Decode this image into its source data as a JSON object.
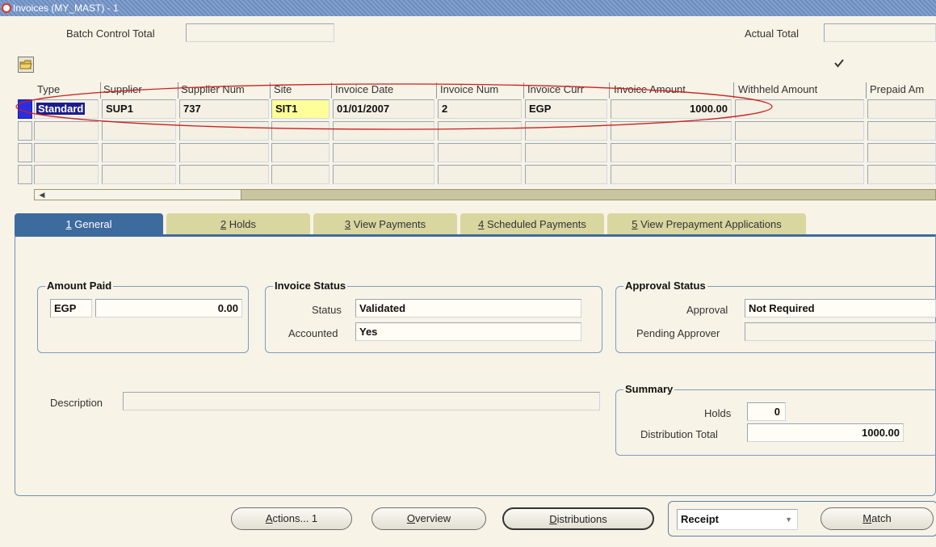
{
  "window": {
    "title": "Invoices (MY_MAST) - 1"
  },
  "batch": {
    "control_label": "Batch Control Total",
    "control_value": "",
    "actual_label": "Actual Total",
    "actual_value": ""
  },
  "grid": {
    "columns": [
      "Type",
      "Supplier",
      "Supplier Num",
      "Site",
      "Invoice Date",
      "Invoice Num",
      "Invoice Curr",
      "Invoice Amount",
      "Withheld Amount",
      "Prepaid Am"
    ],
    "rows": [
      {
        "type": "Standard",
        "supplier": "SUP1",
        "supplier_num": "737",
        "site": "SIT1",
        "invoice_date": "01/01/2007",
        "invoice_num": "2",
        "invoice_curr": "EGP",
        "invoice_amount": "1000.00",
        "withheld_amount": "",
        "prepaid_amount": ""
      }
    ],
    "checkbox_checked": true
  },
  "tabs": [
    {
      "num": "1",
      "label": "General",
      "active": true
    },
    {
      "num": "2",
      "label": "Holds"
    },
    {
      "num": "3",
      "label": "View Payments"
    },
    {
      "num": "4",
      "label": "Scheduled Payments"
    },
    {
      "num": "5",
      "label": "View Prepayment Applications"
    }
  ],
  "amount_paid": {
    "title": "Amount Paid",
    "currency": "EGP",
    "value": "0.00"
  },
  "invoice_status": {
    "title": "Invoice Status",
    "status_label": "Status",
    "status_value": "Validated",
    "accounted_label": "Accounted",
    "accounted_value": "Yes"
  },
  "approval_status": {
    "title": "Approval Status",
    "approval_label": "Approval",
    "approval_value": "Not Required",
    "pending_label": "Pending Approver",
    "pending_value": ""
  },
  "description": {
    "label": "Description",
    "value": ""
  },
  "summary": {
    "title": "Summary",
    "holds_label": "Holds",
    "holds_value": "0",
    "dist_label": "Distribution Total",
    "dist_value": "1000.00"
  },
  "buttons": {
    "actions_accel": "A",
    "actions_rest": "ctions... 1",
    "overview_accel": "O",
    "overview_rest": "verview",
    "distributions_accel": "D",
    "distributions_rest": "istributions",
    "receipt_value": "Receipt",
    "match_accel": "M",
    "match_rest": "atch"
  }
}
